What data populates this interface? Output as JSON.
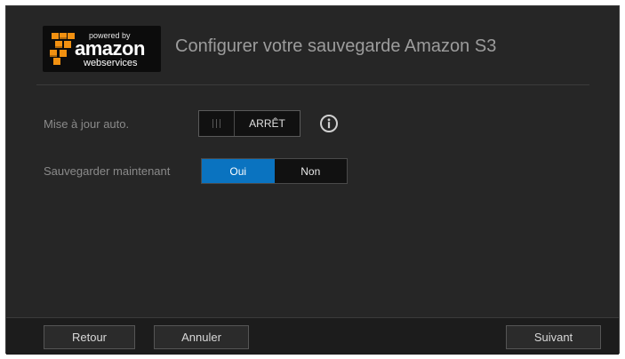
{
  "header": {
    "logo": {
      "powered_by": "powered by",
      "brand": "amazon",
      "tagline": "webservices"
    },
    "title": "Configurer votre sauvegarde Amazon S3"
  },
  "settings": {
    "auto_update": {
      "label": "Mise à jour auto.",
      "state": "ARRÊT",
      "info_icon": "info-icon"
    },
    "backup_now": {
      "label": "Sauvegarder maintenant",
      "options": [
        "Oui",
        "Non"
      ],
      "selected": "Oui"
    }
  },
  "footer": {
    "back_label": "Retour",
    "cancel_label": "Annuler",
    "next_label": "Suivant"
  },
  "colors": {
    "background": "#262626",
    "accent": "#0a73c0",
    "title": "#9c9c9c",
    "label": "#8a8a8a",
    "aws_orange": "#f29111"
  }
}
